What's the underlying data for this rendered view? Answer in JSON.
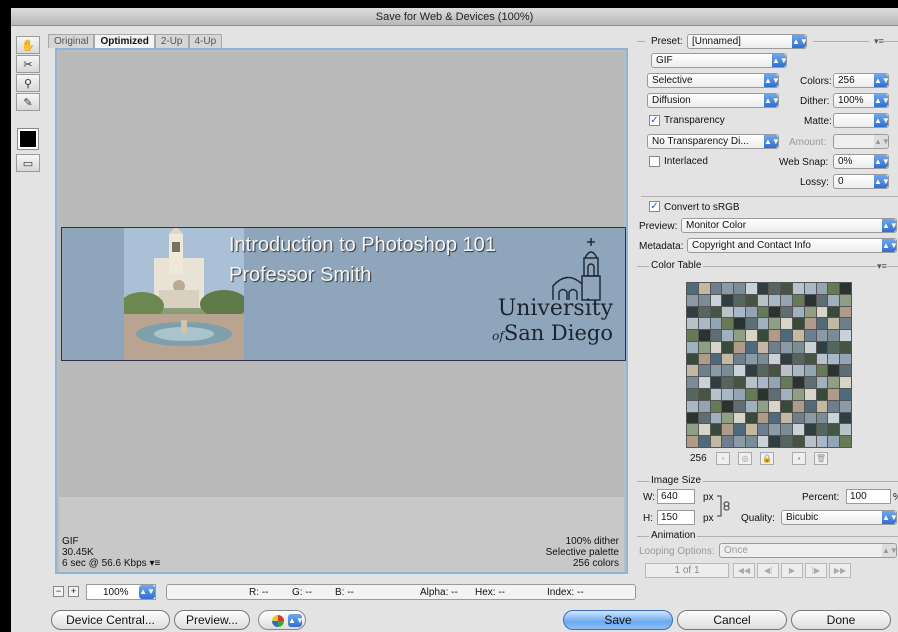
{
  "window": {
    "title": "Save for Web & Devices (100%)"
  },
  "tools": [
    {
      "name": "hand-tool",
      "glyph": "✋"
    },
    {
      "name": "slice-select-tool",
      "glyph": "✂"
    },
    {
      "name": "zoom-tool",
      "glyph": "🔍"
    },
    {
      "name": "eyedropper-tool",
      "glyph": "✎"
    }
  ],
  "tabs": [
    "Original",
    "Optimized",
    "2-Up",
    "4-Up"
  ],
  "banner": {
    "title": "Introduction to Photoshop 101",
    "subtitle": "Professor Smith",
    "logo_line1": "University",
    "logo_of": "of",
    "logo_line2": "San Diego"
  },
  "info": {
    "format": "GIF",
    "size": "30.45K",
    "download": "6 sec @ 56.6 Kbps",
    "dither": "100% dither",
    "palette": "Selective palette",
    "colors": "256 colors"
  },
  "status": {
    "zoom": "100%",
    "r": "R: --",
    "g": "G: --",
    "b": "B: --",
    "alpha": "Alpha: --",
    "hex": "Hex: --",
    "index": "Index: --"
  },
  "buttons": {
    "device_central": "Device Central...",
    "preview": "Preview...",
    "save": "Save",
    "cancel": "Cancel",
    "done": "Done"
  },
  "settings": {
    "preset_label": "Preset:",
    "preset_value": "[Unnamed]",
    "format": "GIF",
    "reduction": "Selective",
    "colors_label": "Colors:",
    "colors_value": "256",
    "dither_algo": "Diffusion",
    "dither_label": "Dither:",
    "dither_value": "100%",
    "transparency_label": "Transparency",
    "transparency_checked": true,
    "matte_label": "Matte:",
    "matte_value": "",
    "transparency_dither": "No Transparency Di...",
    "amount_label": "Amount:",
    "amount_value": "",
    "interlaced_label": "Interlaced",
    "interlaced_checked": false,
    "websnap_label": "Web Snap:",
    "websnap_value": "0%",
    "lossy_label": "Lossy:",
    "lossy_value": "0",
    "convert_label": "Convert to sRGB",
    "convert_checked": true,
    "preview_label": "Preview:",
    "preview_value": "Monitor Color",
    "metadata_label": "Metadata:",
    "metadata_value": "Copyright and Contact Info"
  },
  "color_table": {
    "label": "Color Table",
    "count": "256",
    "palette": [
      "#4f6a7a",
      "#8a9aa6",
      "#2f3e40",
      "#b7c3c8",
      "#667a55",
      "#9fb0bf",
      "#3a4a3a",
      "#c4b8a2",
      "#7a8c96",
      "#56665e",
      "#a8b8c6",
      "#2b3331",
      "#8e9f84",
      "#b09a8a",
      "#6d7f8c",
      "#c9d2d8",
      "#465543",
      "#93a5b4",
      "#5f6d74",
      "#d7d4c8"
    ]
  },
  "image_size": {
    "label": "Image Size",
    "w_label": "W:",
    "w_value": "640",
    "h_label": "H:",
    "h_value": "150",
    "unit": "px",
    "percent_label": "Percent:",
    "percent_value": "100",
    "percent_unit": "%",
    "quality_label": "Quality:",
    "quality_value": "Bicubic"
  },
  "animation": {
    "label": "Animation",
    "looping_label": "Looping Options:",
    "looping_value": "Once",
    "frame": "1 of 1"
  }
}
